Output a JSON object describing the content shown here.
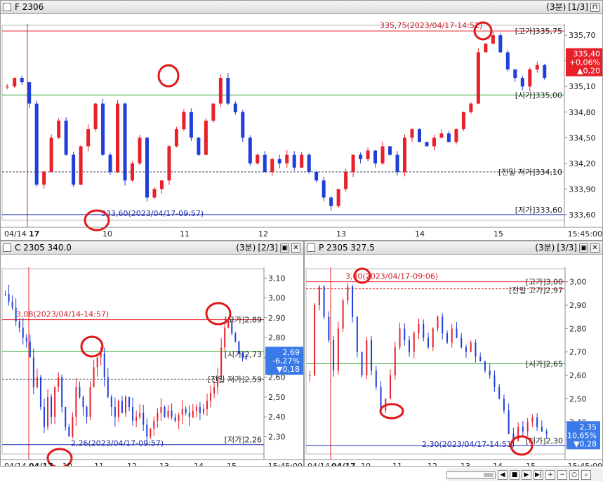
{
  "colors": {
    "up": "#e8202a",
    "down": "#1f3fd8",
    "high_line": "#e8202a",
    "open_line": "#28a028",
    "low_line": "#1f2fb8",
    "prev_line": "#444466",
    "annot_red": "#d0202a",
    "badge_up": "#e8202a",
    "badge_down": "#3a7ae8"
  },
  "panes": [
    {
      "id": "f",
      "title": "F 2306",
      "period": "(3분)",
      "index": "[1/3]",
      "axis_labels": [
        "335,70",
        "335,40",
        "335,10",
        "334,80",
        "334,50",
        "334,20",
        "333,90",
        "333,60"
      ],
      "x_labels": [
        "04/14",
        "17",
        "10",
        "11",
        "12",
        "13",
        "14",
        "15",
        "15:45:00"
      ],
      "high_annot": "335,75(2023/04/17-14:51)",
      "low_annot": "333,60(2023/04/17-09:57)",
      "tag_high": "[고가]335,75",
      "tag_open": "[시가]335,00",
      "tag_prev_low": "[전일 저가]334,10",
      "tag_low": "[저가]333,60",
      "badge": [
        "335,40",
        "+0,06%",
        "▲0,20"
      ],
      "chart_data": {
        "type": "candlestick",
        "title": "F 2306",
        "ylim": [
          333.55,
          335.8
        ],
        "reference_lines": {
          "high": 335.75,
          "open": 335.0,
          "prev_low": 334.1,
          "low": 333.6
        },
        "current": 335.4,
        "series": [
          {
            "values": [
              335.1,
              335.2,
              335.15,
              334.9,
              333.95,
              334.1,
              334.5,
              334.7,
              334.3,
              333.95,
              334.4,
              334.6,
              334.9,
              334.3,
              334.1,
              334.9,
              334.0,
              334.2,
              334.5,
              333.8,
              333.9,
              334.0,
              334.4,
              334.6,
              334.8,
              334.5,
              334.3,
              334.7,
              334.9,
              335.2,
              334.9,
              334.8,
              334.5,
              334.2,
              334.3,
              334.1,
              334.25,
              334.2,
              334.3,
              334.15,
              334.3,
              334.1,
              334.0,
              333.8,
              333.7,
              333.9,
              334.1,
              334.3,
              334.25,
              334.35,
              334.2,
              334.4,
              334.3,
              334.1,
              334.5,
              334.6,
              334.45,
              334.4,
              334.5,
              334.55,
              334.45,
              334.6,
              334.8,
              334.9,
              335.5,
              335.6,
              335.7,
              335.5,
              335.3,
              335.2,
              335.1,
              335.3,
              335.35,
              335.2
            ]
          }
        ]
      }
    },
    {
      "id": "c",
      "title": "C 2305 340.0",
      "period": "(3분)",
      "index": "[2/3]",
      "axis_labels": [
        "3,10",
        "3,00",
        "2,90",
        "2,80",
        "2,70",
        "2,60",
        "2,50",
        "2,40",
        "2,30"
      ],
      "x_labels": [
        "04/14",
        "04/17",
        "10",
        "11",
        "12",
        "13",
        "14",
        "15",
        "15:45:00"
      ],
      "high_annot": "3,08(2023/04/14-14:57)",
      "low_annot": "2,26(2023/04/17-09:57)",
      "tag_high": "[고가]2,89",
      "tag_open": "[시가]2,73",
      "tag_prev_low": "[전일 저가]2,59",
      "tag_low": "[저가]2,26",
      "badge": [
        "2,69",
        "-6,27%",
        "▼0,18"
      ],
      "chart_data": {
        "type": "candlestick",
        "title": "C 2305 340.0",
        "ylim": [
          2.22,
          3.14
        ],
        "reference_lines": {
          "high": 2.89,
          "open": 2.73,
          "prev_low": 2.59,
          "low": 2.26
        },
        "current": 2.69
      }
    },
    {
      "id": "p",
      "title": "P 2305 327.5",
      "period": "(3분)",
      "index": "[3/3]",
      "axis_labels": [
        "3,00",
        "2,90",
        "2,80",
        "2,70",
        "2,60",
        "2,50",
        "2,40",
        "2,30"
      ],
      "x_labels": [
        "04/14",
        "04/17",
        "10",
        "11",
        "12",
        "13",
        "14",
        "15",
        "15:45:00"
      ],
      "high_annot": "3,00(2023/04/17-09:06)",
      "low_annot": "2,30(2023/04/17-14:51)",
      "tag_high": "[고가]3,00",
      "tag_prev_high": "[전일 고가]2,97",
      "tag_open": "[시가]2,65",
      "tag_low": "[저가]2,30",
      "badge": [
        "2,35",
        "-10,65%",
        "▼0,28"
      ],
      "chart_data": {
        "type": "candlestick",
        "title": "P 2305 327.5",
        "ylim": [
          2.27,
          3.05
        ],
        "reference_lines": {
          "high": 3.0,
          "prev_high": 2.97,
          "open": 2.65,
          "low": 2.3
        },
        "current": 2.35
      }
    }
  ]
}
